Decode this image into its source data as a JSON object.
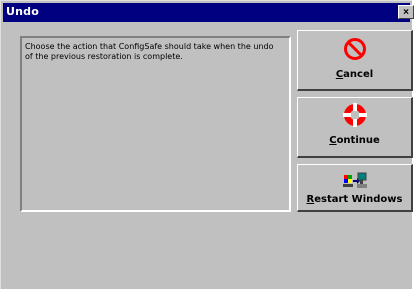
{
  "window": {
    "title": "Undo",
    "close_glyph": "×"
  },
  "message": "Choose the action that ConfigSafe should take when the undo of the previous restoration is complete.",
  "buttons": {
    "cancel": {
      "label": "Cancel",
      "icon": "no-sign-icon",
      "icon_color": "#ff0000"
    },
    "continue": {
      "label": "Continue",
      "icon": "lifebuoy-icon",
      "icon_color": "#ff0000"
    },
    "restart": {
      "label": "Restart Windows",
      "icon": "windows-restart-icon"
    }
  }
}
